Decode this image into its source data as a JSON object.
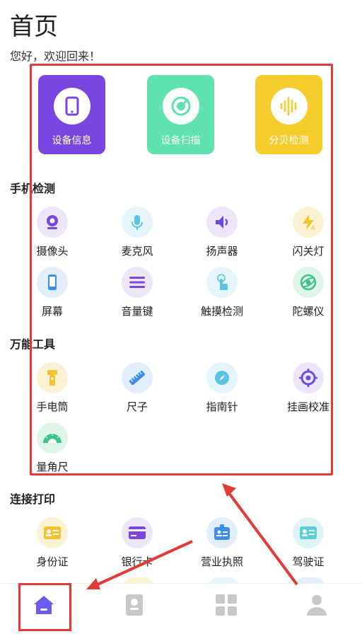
{
  "header": {
    "title": "首页",
    "welcome": "您好，欢迎回来！"
  },
  "top_cards": [
    {
      "label": "设备信息",
      "icon": "tablet-icon",
      "color": "#7a45e0"
    },
    {
      "label": "设备扫描",
      "icon": "scan-icon",
      "color": "#5de2b0"
    },
    {
      "label": "分贝检测",
      "icon": "sound-wave-icon",
      "color": "#f4cc2c"
    }
  ],
  "sections": [
    {
      "title": "手机检测",
      "items": [
        {
          "label": "摄像头",
          "icon": "camera-icon"
        },
        {
          "label": "麦克风",
          "icon": "microphone-icon"
        },
        {
          "label": "扬声器",
          "icon": "speaker-icon"
        },
        {
          "label": "闪关灯",
          "icon": "flash-icon"
        },
        {
          "label": "屏幕",
          "icon": "screen-icon"
        },
        {
          "label": "音量键",
          "icon": "volume-key-icon"
        },
        {
          "label": "触摸检测",
          "icon": "touch-icon"
        },
        {
          "label": "陀螺仪",
          "icon": "gyroscope-icon"
        }
      ]
    },
    {
      "title": "万能工具",
      "items": [
        {
          "label": "手电筒",
          "icon": "flashlight-icon"
        },
        {
          "label": "尺子",
          "icon": "ruler-icon"
        },
        {
          "label": "指南针",
          "icon": "compass-icon"
        },
        {
          "label": "挂画校准",
          "icon": "level-target-icon"
        },
        {
          "label": "量角尺",
          "icon": "protractor-icon"
        }
      ]
    },
    {
      "title": "连接打印",
      "items": [
        {
          "label": "身份证",
          "icon": "id-card-icon"
        },
        {
          "label": "银行卡",
          "icon": "bank-card-icon"
        },
        {
          "label": "营业执照",
          "icon": "business-license-icon"
        },
        {
          "label": "驾驶证",
          "icon": "driver-license-icon"
        }
      ]
    }
  ],
  "bottom_nav": [
    {
      "name": "home",
      "icon": "home-icon",
      "active": true
    },
    {
      "name": "contacts",
      "icon": "contact-card-icon"
    },
    {
      "name": "apps",
      "icon": "grid-icon"
    },
    {
      "name": "profile",
      "icon": "user-icon"
    }
  ],
  "colors": {
    "accent": "#6a5cf0",
    "highlight": "#e53935"
  }
}
